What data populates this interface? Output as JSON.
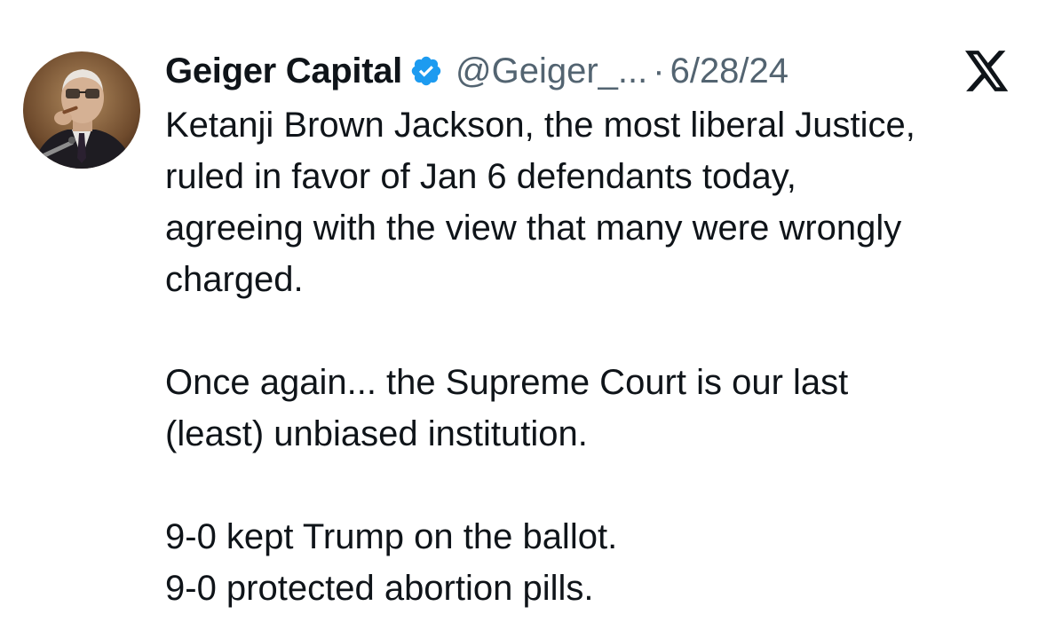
{
  "tweet": {
    "author_name": "Geiger Capital",
    "handle": "@Geiger_...",
    "separator": "·",
    "date": "6/28/24",
    "verified": true,
    "verified_color": "#1d9bf0",
    "platform_icon": "x-logo-icon",
    "paragraphs": [
      [
        "Ketanji Brown Jackson, the most liberal Justice,",
        "ruled in favor of Jan 6 defendants today,",
        "agreeing with the view that many were wrongly",
        "charged."
      ],
      [
        "Once again... the Supreme Court is our last",
        "(least) unbiased institution."
      ],
      [
        "9-0 kept Trump on the ballot.",
        "9-0 protected abortion pills."
      ]
    ]
  }
}
